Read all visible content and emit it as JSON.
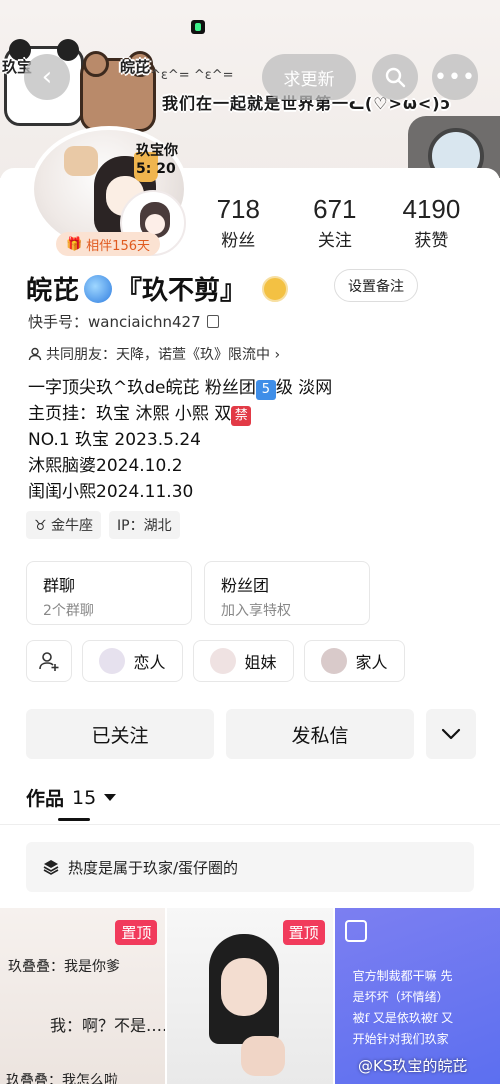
{
  "header": {
    "sticker_left": "玖宝",
    "sticker_right": "皖芘",
    "banner_text": "我们在一起就是世界第一ᓚ(♡>ω<)ɔ",
    "banner_deco": "^ε^=  ^ε^=",
    "back_label": "‹",
    "request_label": "求更新",
    "more_label": "•••"
  },
  "profile": {
    "time_tag_line1": "玖宝你",
    "time_tag_line2": "5: 20",
    "companion_label": "相伴156天",
    "name_part1": "皖芘",
    "name_part2": "『玖不剪』",
    "remark_button": "设置备注",
    "ks_id": "快手号：wanciaichn427",
    "friends": "共同朋友：天降，诺萱《玖》限流中 ›"
  },
  "stats": [
    {
      "num": "718",
      "label": "粉丝"
    },
    {
      "num": "671",
      "label": "关注"
    },
    {
      "num": "4190",
      "label": "获赞"
    }
  ],
  "bio": {
    "line1_a": "一字顶尖玖^玖de皖芘  粉丝团",
    "line1_badge": "5",
    "line1_b": "级  淡网",
    "line2_a": "主页挂：玖宝  沐熙  小熙    双",
    "line2_badge": "禁",
    "line3": "NO.1  玖宝  2023.5.24",
    "line4": "沐熙脑婆2024.10.2",
    "line5": "闺闺小熙2024.11.30"
  },
  "chips": [
    "金牛座",
    "IP：湖北"
  ],
  "boxes": [
    {
      "title": "群聊",
      "sub": "2个群聊"
    },
    {
      "title": "粉丝团",
      "sub": "加入享特权"
    }
  ],
  "relations": [
    "恋人",
    "姐妹",
    "家人"
  ],
  "actions": {
    "follow": "已关注",
    "message": "发私信"
  },
  "tabs": {
    "label": "作品",
    "count": "15"
  },
  "collection": "热度是属于玖家/蛋仔圈的",
  "grid": {
    "pin_label": "置顶",
    "cell1_line1": "玖叠叠：我是你爹",
    "cell1_line2": "我：啊？不是……",
    "cell1_line3": "玖叠叠：我怎么啦",
    "cell3_line1": "官方制裁都干嘛 先",
    "cell3_line2": "是坏坏（坏情绪）",
    "cell3_line3": "被f 又是依玖被f 又",
    "cell3_line4": "开始针对我们玖家",
    "watermark": "@KS玖宝的皖芘"
  }
}
